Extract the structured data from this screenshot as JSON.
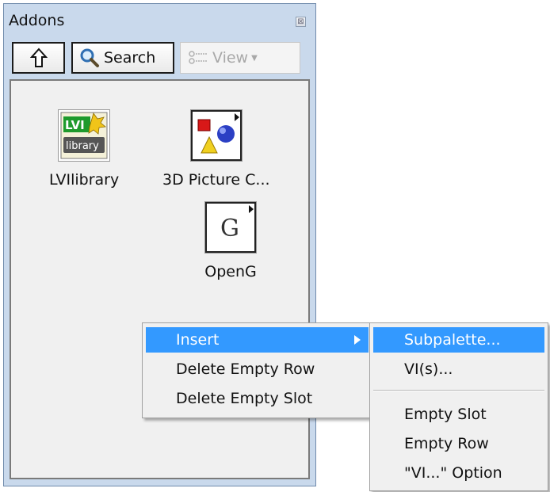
{
  "window": {
    "title": "Addons",
    "close_glyph": "⊠"
  },
  "toolbar": {
    "up_icon": "up-arrow-icon",
    "search_label": "Search",
    "view_label": "View",
    "view_enabled": false
  },
  "palette_items": [
    {
      "label": "LVIlibrary",
      "icon": "lvi-library-icon"
    },
    {
      "label": "3D Picture C...",
      "icon": "3d-picture-icon"
    },
    {
      "label": "OpenG",
      "icon": "openg-icon"
    }
  ],
  "context_menu": {
    "items": [
      {
        "label": "Insert",
        "highlighted": true,
        "has_submenu": true
      },
      {
        "label": "Delete Empty Row",
        "highlighted": false
      },
      {
        "label": "Delete Empty Slot",
        "highlighted": false
      }
    ]
  },
  "insert_submenu": {
    "items": [
      {
        "label": "Subpalette...",
        "highlighted": true
      },
      {
        "label": "VI(s)...",
        "highlighted": false
      },
      {
        "label": "Empty Slot",
        "highlighted": false
      },
      {
        "label": "Empty Row",
        "highlighted": false
      },
      {
        "label": "\"VI...\" Option",
        "highlighted": false
      }
    ]
  },
  "colors": {
    "highlight": "#3399ff",
    "window_frame": "#c9d9ec"
  }
}
